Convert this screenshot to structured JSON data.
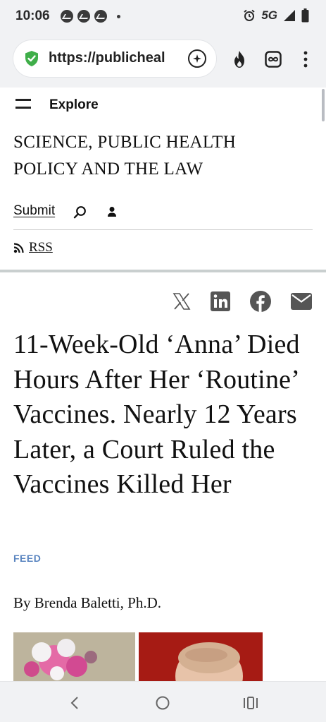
{
  "status_bar": {
    "time": "10:06",
    "network": "5G",
    "notification_icons": [
      "messenger-icon",
      "messenger-icon",
      "messenger-icon"
    ]
  },
  "browser": {
    "url": "https://publicheal",
    "icons": [
      "shield-check-icon",
      "new-chat-icon",
      "fire-icon",
      "infinity-icon",
      "more-vert-icon"
    ]
  },
  "site": {
    "menu_label": "Explore",
    "title": "SCIENCE, PUBLIC HEALTH POLICY AND THE LAW",
    "submit_label": "Submit",
    "rss_label": "RSS"
  },
  "share": [
    "x-icon",
    "linkedin-icon",
    "facebook-icon",
    "mail-icon"
  ],
  "article": {
    "title": "11-Week-Old ‘Anna’ Died Hours After Her ‘Routine’ Vaccines. Nearly 12 Years Later, a Court Ruled the Vaccines Killed Her",
    "category": "FEED",
    "byline": "By Brenda Baletti, Ph.D."
  },
  "colors": {
    "accent_feed": "#5a85c0",
    "shield_green": "#3fae49",
    "bar_bg": "#f1f2f4"
  }
}
